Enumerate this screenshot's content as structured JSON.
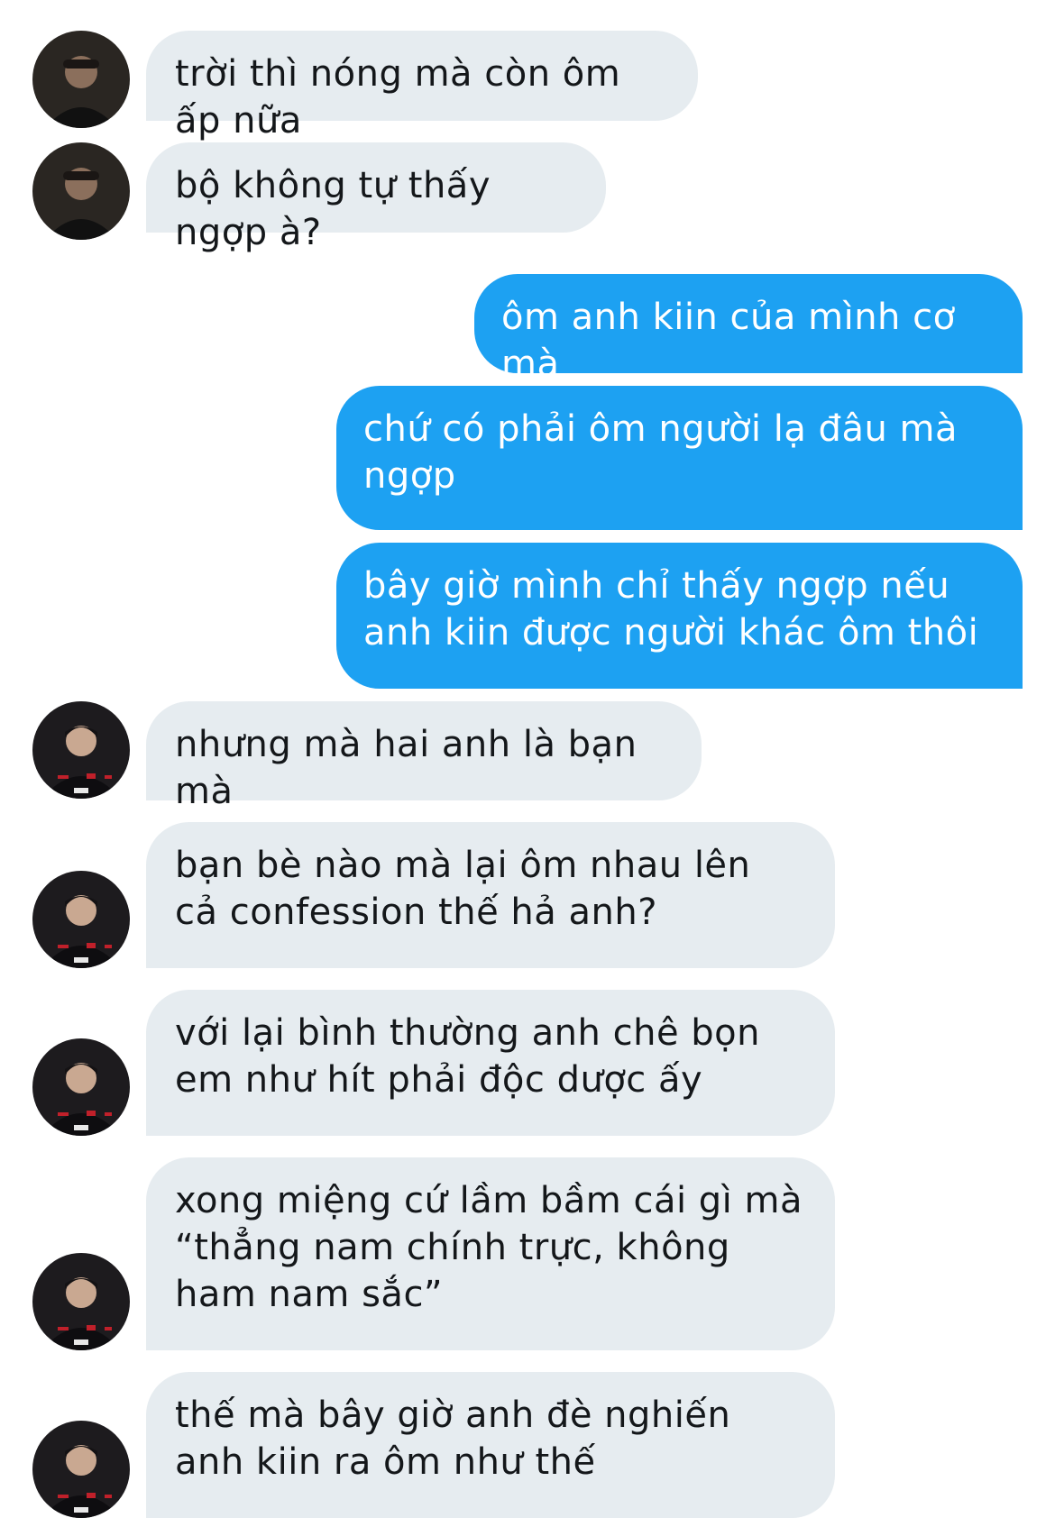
{
  "conversation": {
    "messages": [
      {
        "from": "kiin",
        "text": "trời thì nóng mà còn ôm ấp nữa"
      },
      {
        "from": "kiin",
        "text": "bộ không tự thấy ngợp à?"
      },
      {
        "from": "me",
        "text": "ôm anh kiin của mình cơ mà"
      },
      {
        "from": "me",
        "text": "chứ có phải ôm người lạ đâu mà ngợp"
      },
      {
        "from": "me",
        "text": "bây giờ mình chỉ thấy ngợp nếu anh kiin được người khác ôm thôi"
      },
      {
        "from": "player",
        "text": "nhưng mà hai anh là bạn mà"
      },
      {
        "from": "player",
        "text": "bạn bè nào mà lại ôm nhau lên cả confession thế hả anh?"
      },
      {
        "from": "player",
        "text": "với lại bình thường anh chê bọn em như hít phải độc dược ấy"
      },
      {
        "from": "player",
        "text": "xong miệng cứ lầm bầm cái gì mà “thẳng nam chính trực, không ham nam sắc”"
      },
      {
        "from": "player",
        "text": "thế mà bây giờ anh đè nghiến anh kiin ra ôm như thế"
      }
    ]
  },
  "avatars": {
    "kiin": "avatar-photo-dark",
    "player": "avatar-photo-jersey"
  },
  "colors": {
    "received_bubble": "#e6ecf0",
    "sent_bubble": "#1da1f2",
    "received_text": "#14171a",
    "sent_text": "#ffffff"
  }
}
